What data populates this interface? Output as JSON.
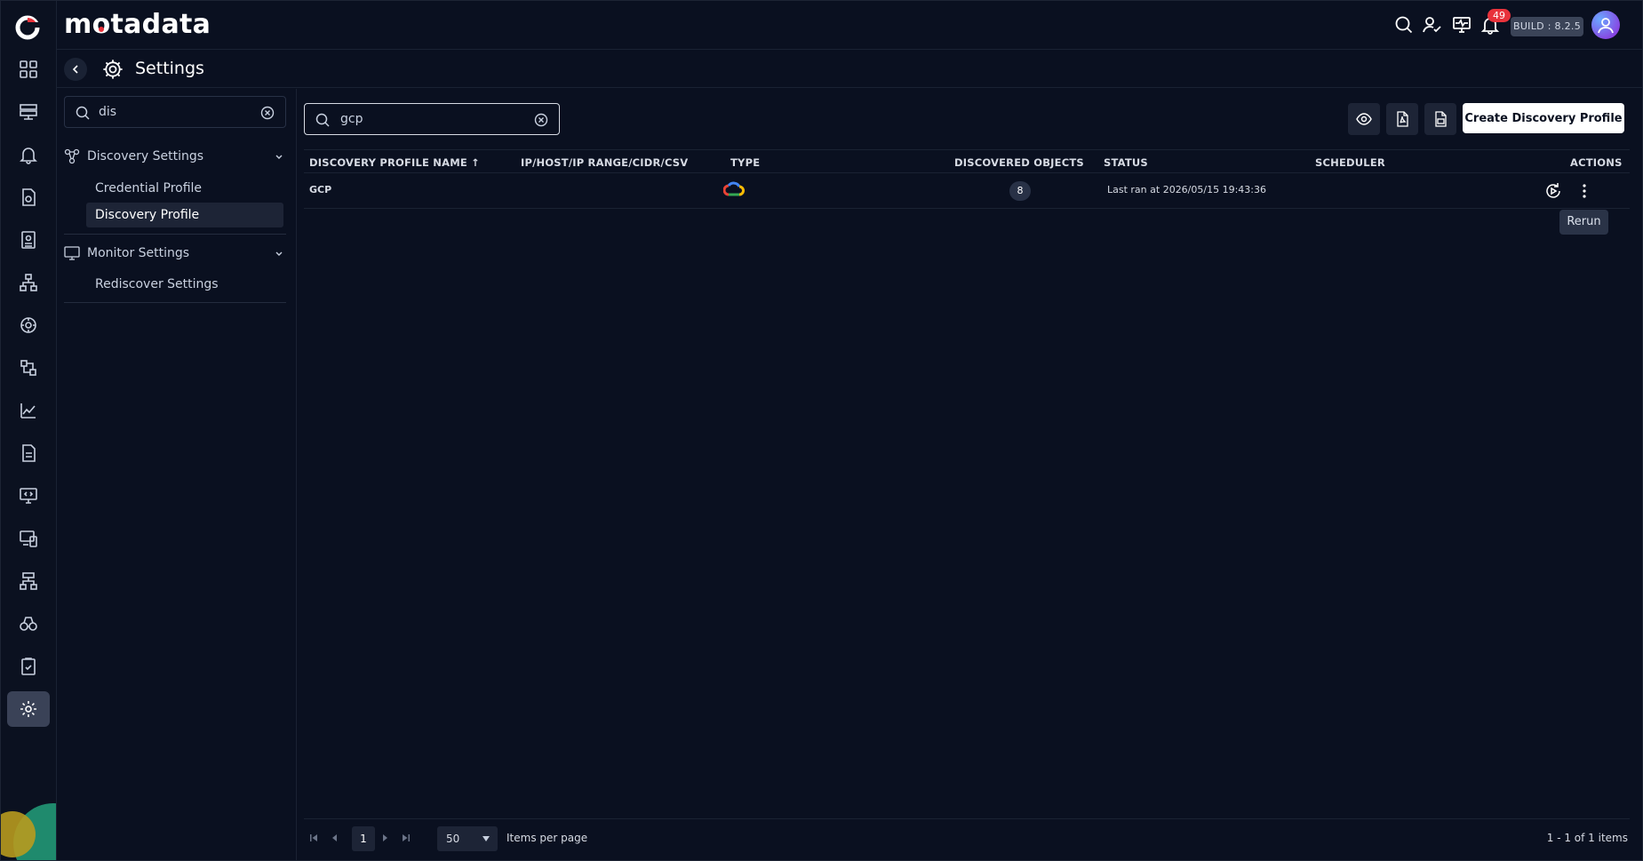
{
  "brand": {
    "name_prefix": "m",
    "name_o": "o",
    "name_suffix": "tadata"
  },
  "topbar": {
    "notification_count": "49",
    "build_label": "BUILD : 8.2.5"
  },
  "page": {
    "title": "Settings"
  },
  "settings_panel": {
    "search": {
      "value": "dis"
    },
    "groups": [
      {
        "label": "Discovery Settings",
        "items": [
          {
            "label": "Credential Profile",
            "active": false
          },
          {
            "label": "Discovery Profile",
            "active": true
          }
        ]
      },
      {
        "label": "Monitor Settings",
        "items": [
          {
            "label": "Rediscover Settings",
            "active": false
          }
        ]
      }
    ]
  },
  "main": {
    "search": {
      "value": "gcp"
    },
    "create_button": "Create Discovery Profile",
    "table": {
      "columns": [
        "DISCOVERY PROFILE NAME ↑",
        "IP/HOST/IP RANGE/CIDR/CSV",
        "TYPE",
        "DISCOVERED OBJECTS",
        "STATUS",
        "SCHEDULER",
        "ACTIONS"
      ],
      "rows": [
        {
          "name": "GCP",
          "target": "",
          "type_icon": "gcp-cloud-icon",
          "discovered_objects": "8",
          "status": "Last ran at 2026/05/15 19:43:36",
          "scheduler": ""
        }
      ]
    },
    "tooltip": "Rerun",
    "pager": {
      "current_page": "1",
      "page_size": "50",
      "page_size_label": "Items per page",
      "info": "1 - 1 of 1 items"
    }
  },
  "colors": {
    "background": "#0a1020",
    "accent_red": "#e8323b",
    "active_bg": "#3a4257"
  }
}
